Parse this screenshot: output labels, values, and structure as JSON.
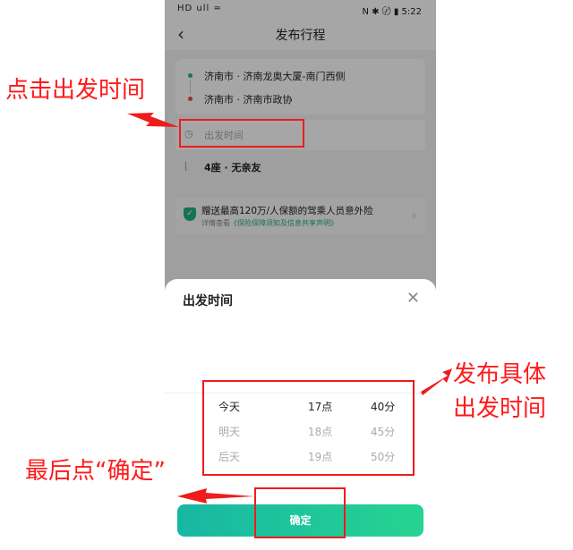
{
  "statusbar": {
    "left": "HD ull ≈",
    "right": "N ✱ 〄 ▮ 5:22"
  },
  "nav": {
    "title": "发布行程"
  },
  "route": {
    "from": "济南市 · 济南龙奥大厦-南门西侧",
    "to": "济南市 · 济南市政协"
  },
  "time_row": {
    "placeholder": "出发时间"
  },
  "seats_row": {
    "text": "4座 · 无亲友"
  },
  "insurance": {
    "line1": "赠送最高120万/人保额的驾乘人员意外险",
    "line2_prefix": "详情查看",
    "line2_link": "《保险保障须知及信息共享声明》"
  },
  "sheet": {
    "title": "出发时间",
    "confirm": "确定"
  },
  "picker": {
    "rows": [
      {
        "day": "今天",
        "hour": "17点",
        "minute": "40分"
      },
      {
        "day": "明天",
        "hour": "18点",
        "minute": "45分"
      },
      {
        "day": "后天",
        "hour": "19点",
        "minute": "50分"
      }
    ],
    "selected_index": 0
  },
  "annotations": {
    "a1": "点击出发时间",
    "a2_line1": "发布具体",
    "a2_line2": "出发时间",
    "a3": "最后点“确定”"
  },
  "colors": {
    "accent": "#1fb37b",
    "button_gradient_start": "#17b7a3",
    "button_gradient_end": "#27d391",
    "annotation_red": "#ff1a1a"
  }
}
